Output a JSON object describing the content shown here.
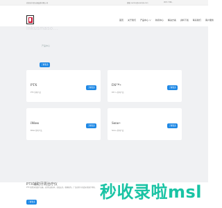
{
  "topbar": {
    "welcome": "欢迎访问某仪器设备有限公司",
    "email": "邮箱: service@example.com",
    "phone": "0577-7788..."
  },
  "nav": [
    "首页",
    "关于我们",
    "产品中心 ∨",
    "新闻中心",
    "解决方案",
    "资料下载",
    "联系我们",
    "客户服务"
  ],
  "hero": {
    "title": "Inkusmaso...",
    "subtitle": "产品中心",
    "button": "了解更多"
  },
  "cards": [
    {
      "name": "PTX",
      "desc": "PTX 系列产品",
      "button": "了解更多"
    },
    {
      "name": "DS™+",
      "desc": "DS™+ 系列产品",
      "button": "了解更多"
    },
    {
      "name": "iMoss",
      "desc": "iMoss 系列产品",
      "button": "了解更多"
    },
    {
      "name": "Sono+",
      "desc": "Sono+ 系列产品",
      "button": "了解更多"
    }
  ],
  "bottom": {
    "title": "PTX辅助牙周治疗仪",
    "text": "PTX 新型牙周治疗仪器，应用先进技术，高效安全，便捷操作，广泛适用于各类牙周治疗场景。",
    "button": "了解更多"
  },
  "watermark": "秒收录啦msl"
}
